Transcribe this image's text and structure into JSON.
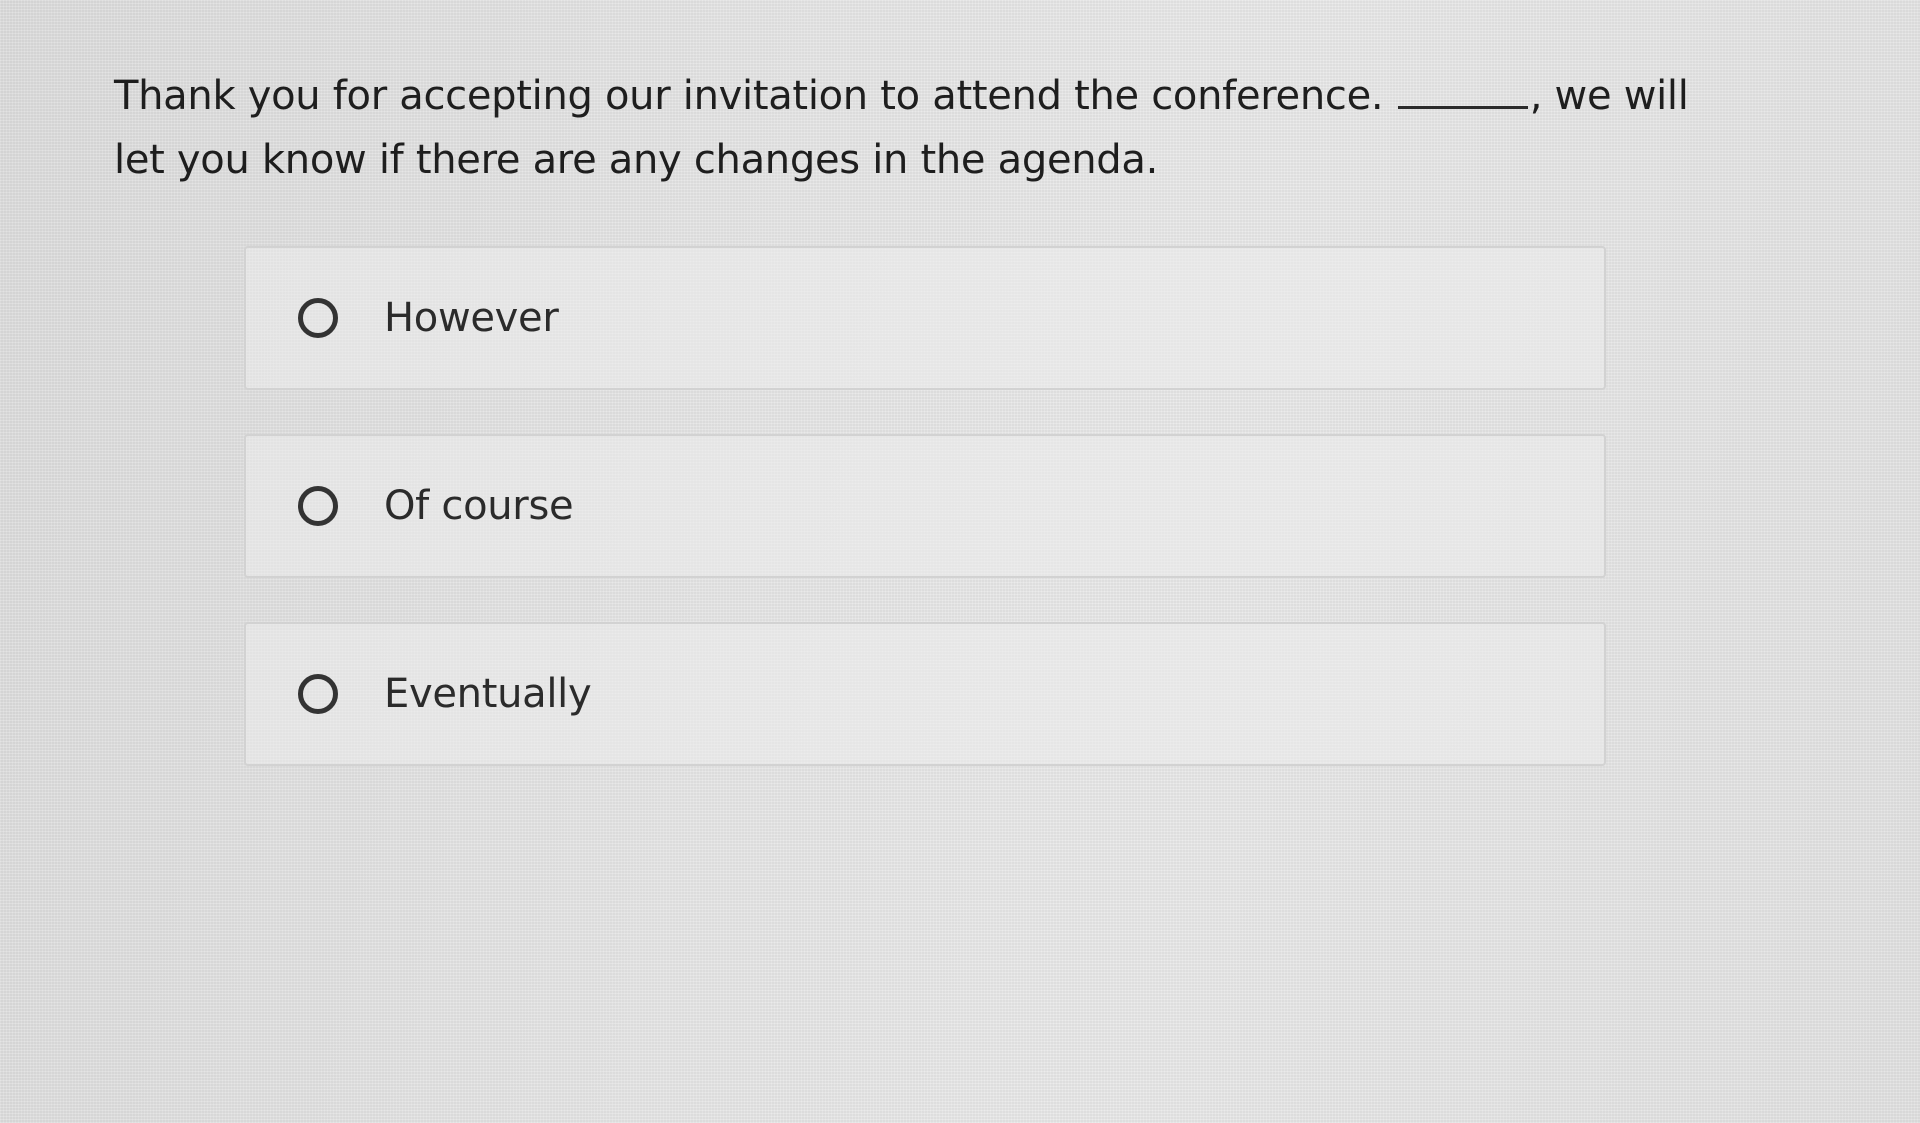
{
  "question": {
    "text_before_blank": "Thank you for accepting our invitation to attend the conference.",
    "text_after_blank": ", we will let you know if there are any changes in the agenda."
  },
  "options": [
    {
      "label": "However",
      "selected": false
    },
    {
      "label": "Of course",
      "selected": false
    },
    {
      "label": "Eventually",
      "selected": false
    }
  ]
}
